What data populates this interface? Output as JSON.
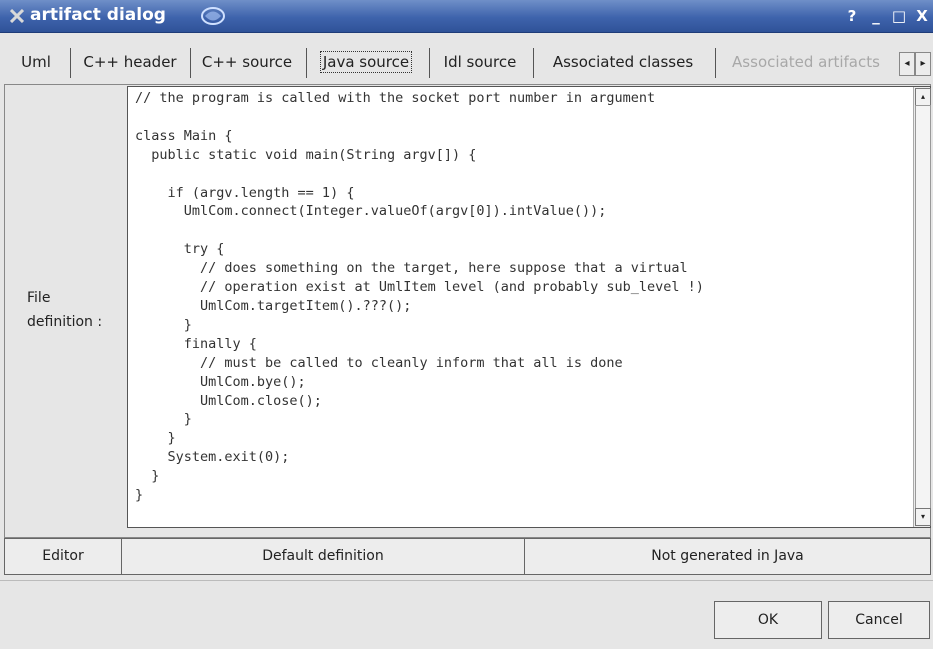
{
  "window": {
    "title": "artifact dialog",
    "help_button": "?",
    "minimize_button": "_",
    "maximize_button": "□",
    "close_button": "X"
  },
  "tabs": [
    {
      "label": "Uml",
      "state": "normal"
    },
    {
      "label": "C++ header",
      "state": "normal"
    },
    {
      "label": "C++ source",
      "state": "normal"
    },
    {
      "label": "Java source",
      "state": "selected"
    },
    {
      "label": "Idl source",
      "state": "normal"
    },
    {
      "label": "Associated classes",
      "state": "normal"
    },
    {
      "label": "Associated artifacts",
      "state": "disabled"
    }
  ],
  "tab_scroll": {
    "left": "◂",
    "right": "▸"
  },
  "file_definition": {
    "label": "File\ndefinition :",
    "code": "// the program is called with the socket port number in argument\n\nclass Main {\n  public static void main(String argv[]) {\n\n    if (argv.length == 1) {\n      UmlCom.connect(Integer.valueOf(argv[0]).intValue());\n\n      try {\n        // does something on the target, here suppose that a virtual\n        // operation exist at UmlItem level (and probably sub_level !)\n        UmlCom.targetItem().???();\n      }\n      finally {\n        // must be called to cleanly inform that all is done\n        UmlCom.bye();\n        UmlCom.close();\n      }\n    }\n    System.exit(0);\n  }\n}"
  },
  "scrollbar": {
    "up": "▴",
    "down": "▾"
  },
  "buttons": {
    "editor": "Editor",
    "default_definition": "Default definition",
    "not_generated": "Not generated in Java",
    "ok": "OK",
    "cancel": "Cancel"
  },
  "colors": {
    "titlebar": "#3e63ac",
    "window_bg": "#e6e6e6",
    "editor_bg": "#ffffff",
    "disabled_text": "#a8a8a8"
  }
}
